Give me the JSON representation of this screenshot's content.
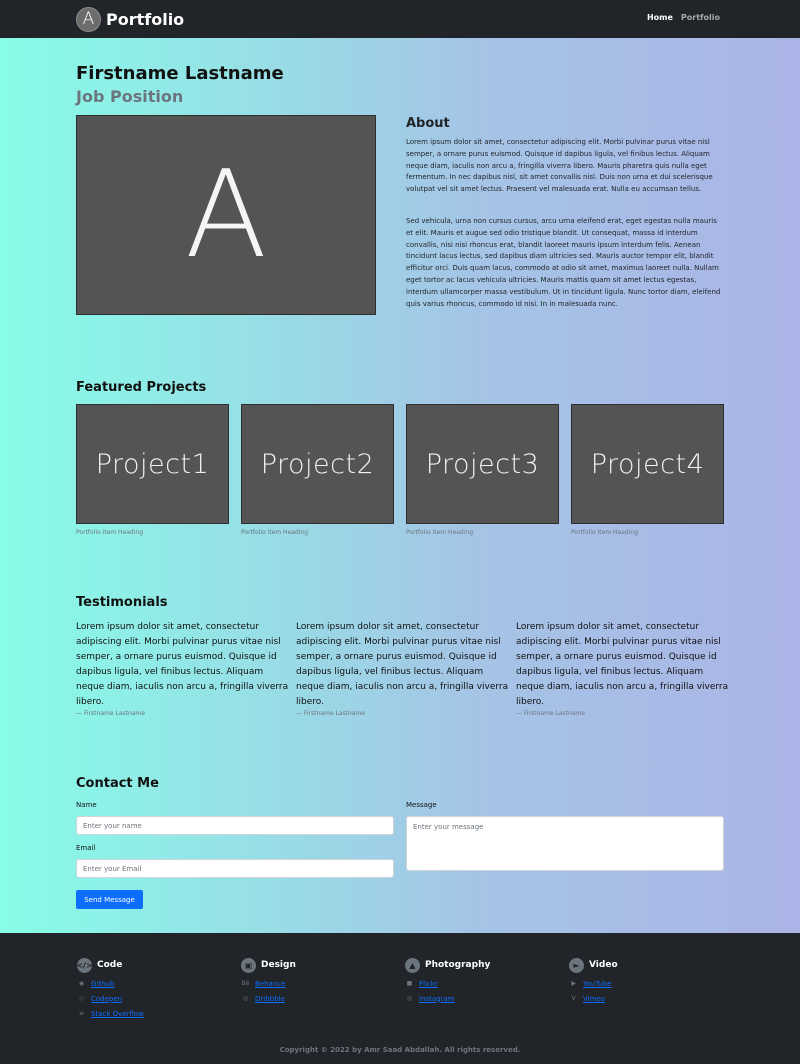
{
  "navbar": {
    "logo_letter": "A",
    "brand": "Portfolio",
    "links": [
      "Home",
      "Portfolio"
    ]
  },
  "profile": {
    "name": "Firstname Lastname",
    "position": "Job Position",
    "image_letter": "A"
  },
  "about": {
    "title": "About",
    "p1": "Lorem ipsum dolor sit amet, consectetur adipiscing elit. Morbi pulvinar purus vitae nisl semper, a ornare purus euismod. Quisque id dapibus ligula, vel finibus lectus. Aliquam neque diam, iaculis non arcu a, fringilla viverra libero. Mauris pharetra quis nulla eget fermentum. In nec dapibus nisl, sit amet convallis nisl. Duis non urna et dui scelerisque volutpat vel sit amet lectus. Praesent vel malesuada erat. Nulla eu accumsan tellus.",
    "p2": "Sed vehicula, urna non cursus cursus, arcu urna eleifend erat, eget egestas nulla mauris et elit. Mauris et augue sed odio tristique blandit. Ut consequat, massa id interdum convallis, nisi nisi rhoncus erat, blandit laoreet mauris ipsum interdum felis. Aenean tincidunt lacus lectus, sed dapibus diam ultricies sed. Mauris auctor tempor elit, blandit efficitur orci. Duis quam lacus, commodo at odio sit amet, maximus laoreet nulla. Nullam eget tortor ac lacus vehicula ultricies. Mauris mattis quam sit amet lectus egestas, interdum ullamcorper massa vestibulum. Ut in tincidunt ligula. Nunc tortor diam, eleifend quis varius rhoncus, commodo id nisi. In in malesuada nunc."
  },
  "projects": {
    "title": "Featured Projects",
    "items": [
      {
        "label": "Project1",
        "caption": "Portfolio item Heading"
      },
      {
        "label": "Project2",
        "caption": "Portfolio item Heading"
      },
      {
        "label": "Project3",
        "caption": "Portfolio item Heading"
      },
      {
        "label": "Project4",
        "caption": "Portfolio item Heading"
      }
    ]
  },
  "testimonials": {
    "title": "Testimonials",
    "items": [
      {
        "text": "Lorem ipsum dolor sit amet, consectetur adipiscing elit. Morbi pulvinar purus vitae nisl semper, a ornare purus euismod. Quisque id dapibus ligula, vel finibus lectus. Aliquam neque diam, iaculis non arcu a, fringilla viverra libero.",
        "author": "— Firstname Lastname"
      },
      {
        "text": "Lorem ipsum dolor sit amet, consectetur adipiscing elit. Morbi pulvinar purus vitae nisl semper, a ornare purus euismod. Quisque id dapibus ligula, vel finibus lectus. Aliquam neque diam, iaculis non arcu a, fringilla viverra libero.",
        "author": "— Firstname Lastname"
      },
      {
        "text": "Lorem ipsum dolor sit amet, consectetur adipiscing elit. Morbi pulvinar purus vitae nisl semper, a ornare purus euismod. Quisque id dapibus ligula, vel finibus lectus. Aliquam neque diam, iaculis non arcu a, fringilla viverra libero.",
        "author": "— Firstname Lastname"
      }
    ]
  },
  "contact": {
    "title": "Contact Me",
    "name_label": "Name",
    "name_placeholder": "Enter your name",
    "email_label": "Email",
    "email_placeholder": "Enter your Email",
    "message_label": "Message",
    "message_placeholder": "Enter your message",
    "send_label": "Send Message"
  },
  "footer": {
    "columns": [
      {
        "title": "Code",
        "icon": "code-icon",
        "links": [
          {
            "icon": "github-icon",
            "label": "Github"
          },
          {
            "icon": "codepen-icon",
            "label": "Codepen"
          },
          {
            "icon": "stack-overflow-icon",
            "label": "Stack Overflow"
          }
        ]
      },
      {
        "title": "Design",
        "icon": "design-icon",
        "links": [
          {
            "icon": "behance-icon",
            "label": "Behance"
          },
          {
            "icon": "dribbble-icon",
            "label": "Dribbble"
          }
        ]
      },
      {
        "title": "Photography",
        "icon": "photo-icon",
        "links": [
          {
            "icon": "flickr-icon",
            "label": "Flickr"
          },
          {
            "icon": "instagram-icon",
            "label": "Instagram"
          }
        ]
      },
      {
        "title": "Video",
        "icon": "video-icon",
        "links": [
          {
            "icon": "youtube-icon",
            "label": "YouTube"
          },
          {
            "icon": "vimeo-icon",
            "label": "Vimeo"
          }
        ]
      }
    ],
    "copyright": "Copyright © 2022 by Amr Saad Abdallah. All rights reserved."
  },
  "colors": {
    "navbar_bg": "#212529",
    "gradient_start": "#87fde7",
    "gradient_end": "#abb4e6",
    "placeholder_bg": "#545454",
    "primary": "#0d6efd"
  }
}
